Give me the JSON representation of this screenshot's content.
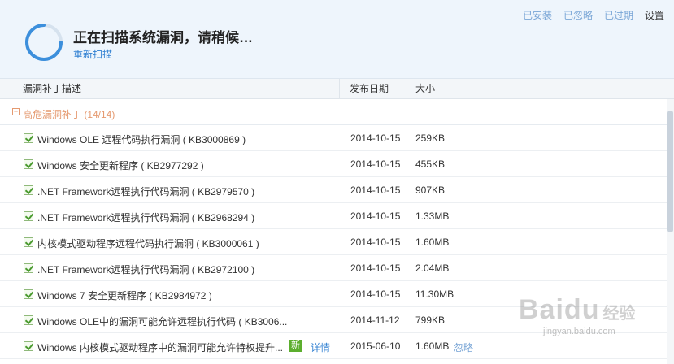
{
  "header": {
    "title": "正在扫描系统漏洞，请稍候…",
    "rescan_label": "重新扫描",
    "links": {
      "installed": "已安装",
      "ignored": "已忽略",
      "expired": "已过期",
      "settings": "设置"
    }
  },
  "columns": {
    "desc": "漏洞补丁描述",
    "date": "发布日期",
    "size": "大小"
  },
  "group": {
    "toggle": "−",
    "label": "高危漏洞补丁 (14/14)"
  },
  "rows": [
    {
      "name": "Windows OLE 远程代码执行漏洞 ( KB3000869 )",
      "date": "2014-10-15",
      "size": "259KB"
    },
    {
      "name": "Windows 安全更新程序 ( KB2977292 )",
      "date": "2014-10-15",
      "size": "455KB"
    },
    {
      "name": ".NET Framework远程执行代码漏洞 ( KB2979570 )",
      "date": "2014-10-15",
      "size": "907KB"
    },
    {
      "name": ".NET Framework远程执行代码漏洞 ( KB2968294 )",
      "date": "2014-10-15",
      "size": "1.33MB"
    },
    {
      "name": "内核模式驱动程序远程代码执行漏洞 ( KB3000061 )",
      "date": "2014-10-15",
      "size": "1.60MB"
    },
    {
      "name": ".NET Framework远程执行代码漏洞 ( KB2972100 )",
      "date": "2014-10-15",
      "size": "2.04MB"
    },
    {
      "name": "Windows 7 安全更新程序 ( KB2984972 )",
      "date": "2014-10-15",
      "size": "11.30MB"
    },
    {
      "name": "Windows OLE中的漏洞可能允许远程执行代码 ( KB3006...",
      "date": "2014-11-12",
      "size": "799KB"
    },
    {
      "name": "Windows 内核模式驱动程序中的漏洞可能允许特权提升...",
      "date": "2015-06-10",
      "size": "1.60MB",
      "badge": "新",
      "detail": "详情",
      "ignore": "忽略"
    }
  ],
  "watermark": {
    "logo": "Bai",
    "logo2": "du",
    "sub": "经验",
    "url": "jingyan.baidu.com"
  },
  "colors": {
    "accent": "#2f7fd1",
    "group": "#e59a70",
    "new_badge": "#5cae2e",
    "check": "#4a9a2f"
  },
  "icons": {
    "spinner": "loading-spinner-icon",
    "checkbox": "checkbox-checked-icon",
    "collapse": "collapse-icon"
  }
}
